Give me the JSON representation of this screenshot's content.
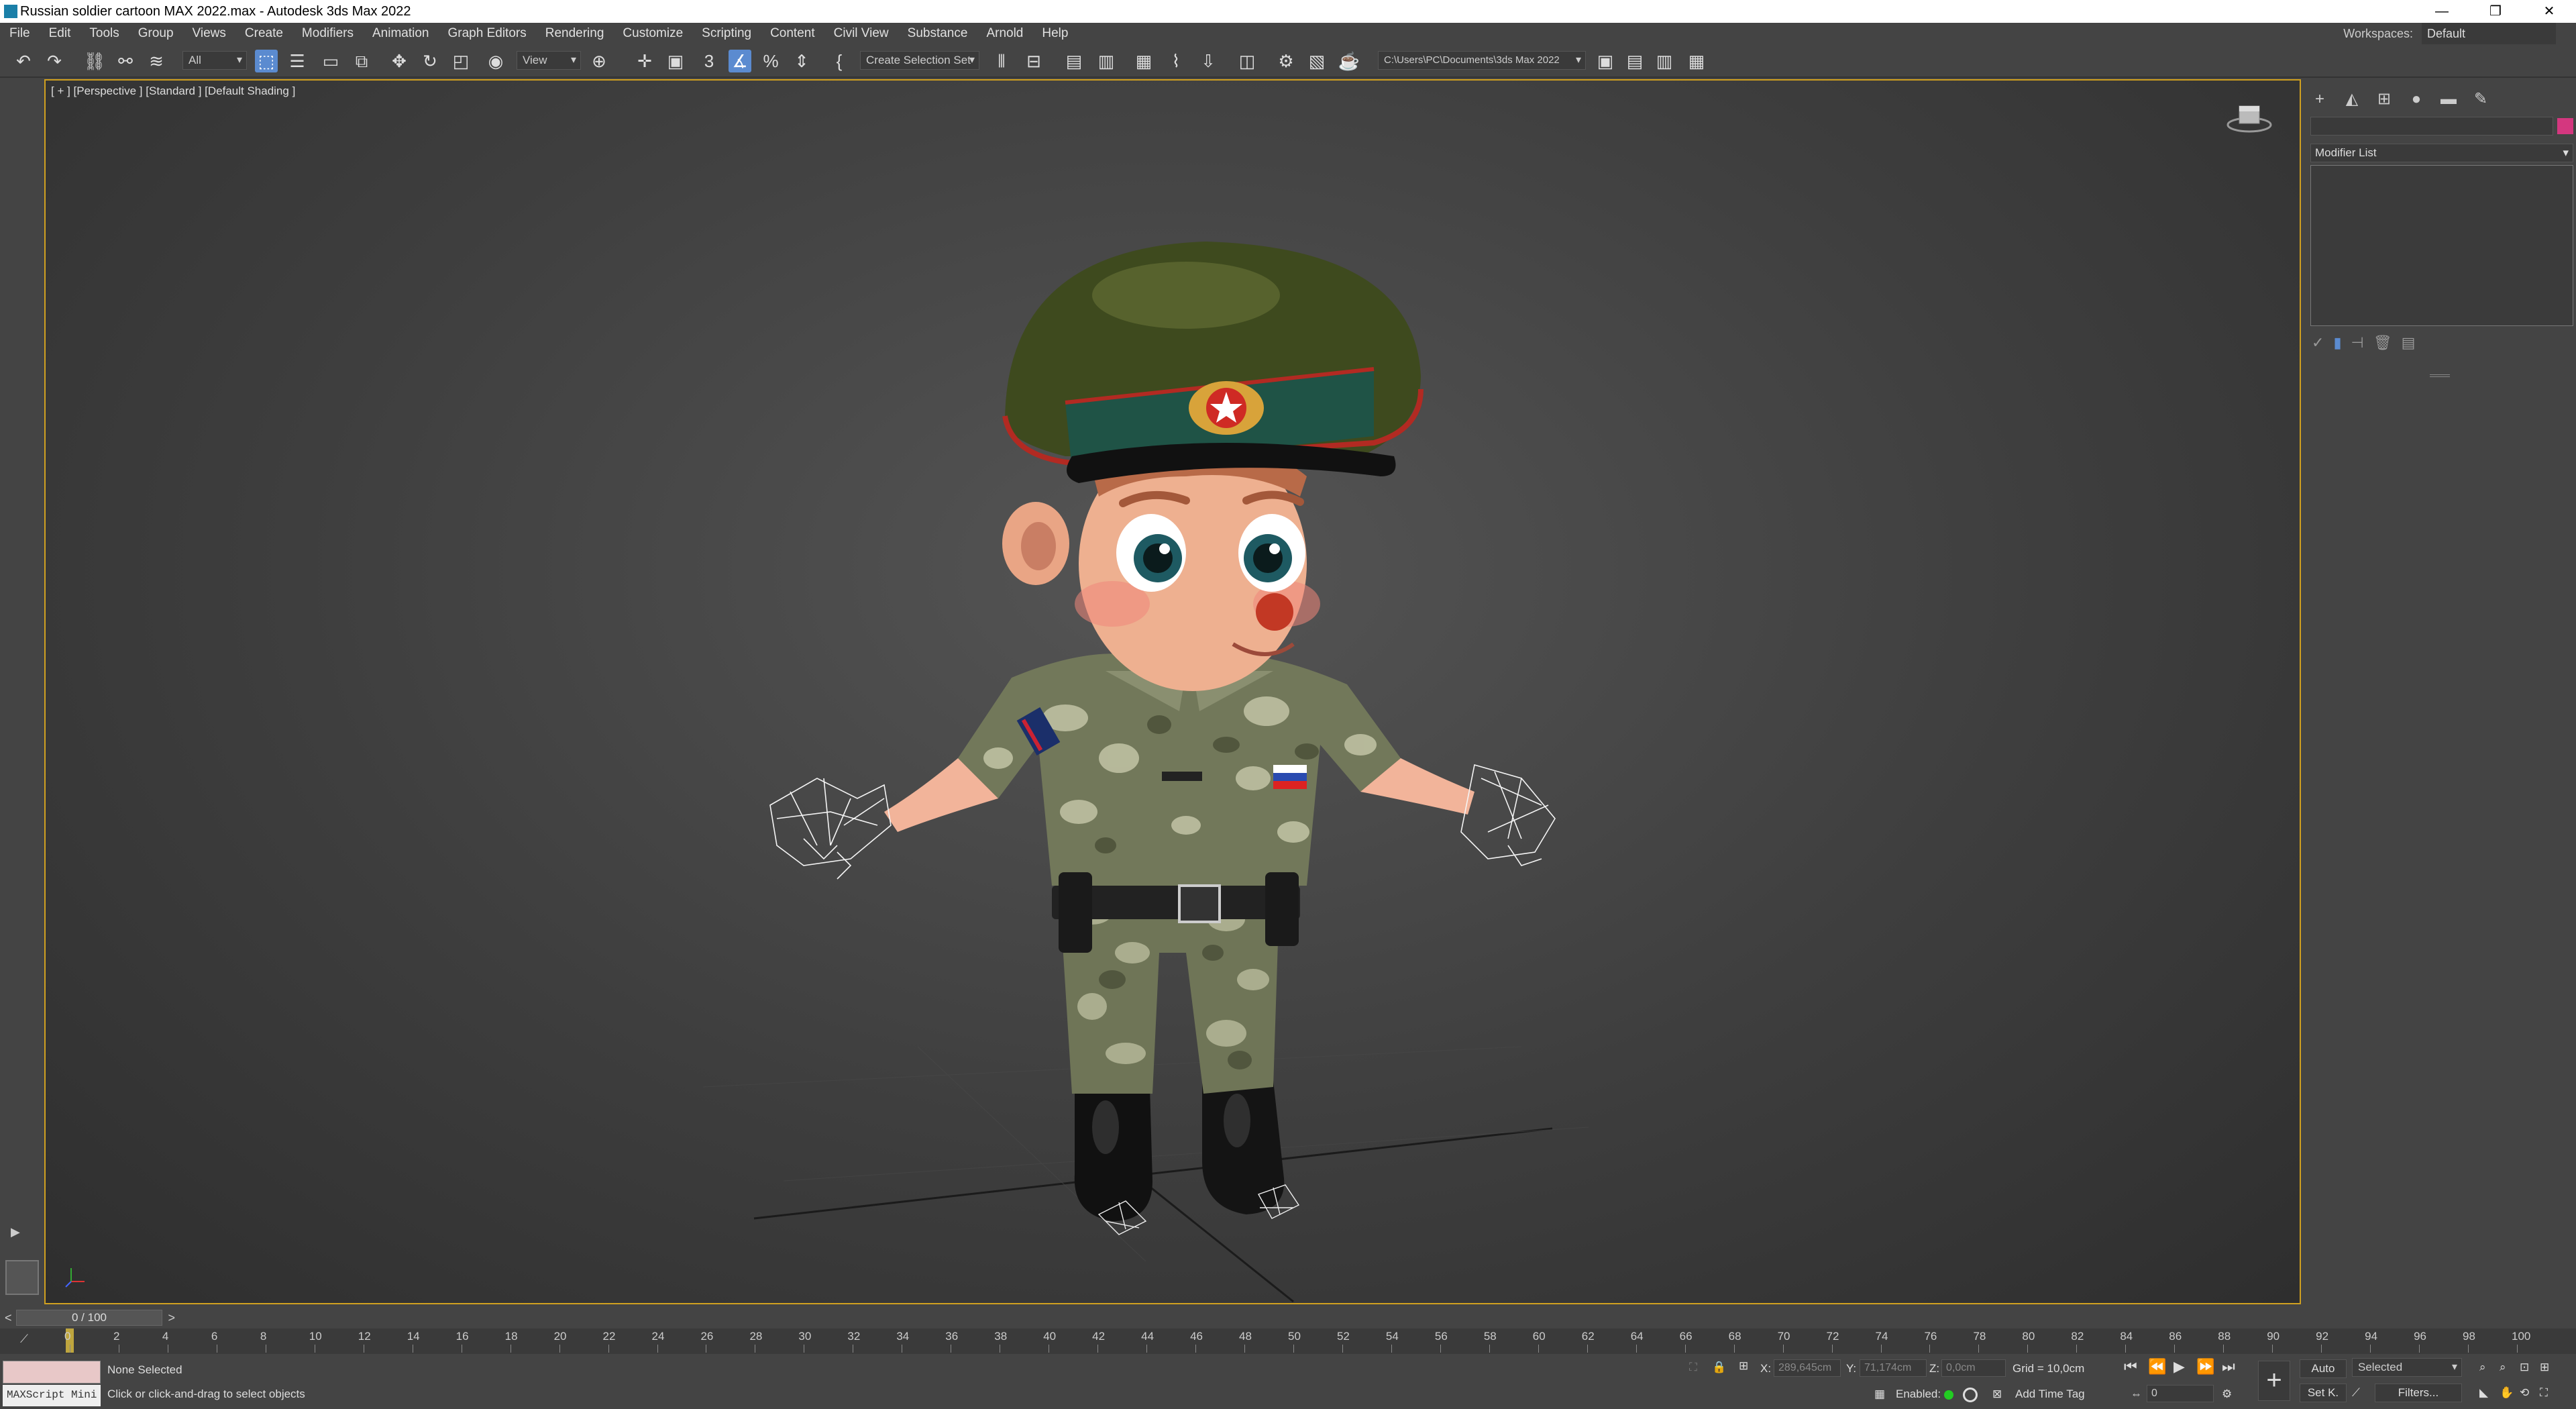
{
  "window": {
    "title": "Russian soldier cartoon MAX 2022.max - Autodesk 3ds Max 2022",
    "minimize": "—",
    "restore": "❐",
    "close": "✕"
  },
  "menu": [
    "File",
    "Edit",
    "Tools",
    "Group",
    "Views",
    "Create",
    "Modifiers",
    "Animation",
    "Graph Editors",
    "Rendering",
    "Customize",
    "Scripting",
    "Content",
    "Civil View",
    "Substance",
    "Arnold",
    "Help"
  ],
  "workspace": {
    "label": "Workspaces:",
    "value": "Default"
  },
  "toolbar": {
    "selection_filter": "All",
    "ref_coord": "View",
    "selection_set": "Create Selection Set",
    "project_path": "C:\\Users\\PC\\Documents\\3ds Max 2022",
    "snap_label": "3"
  },
  "viewport": {
    "label": "[ + ] [Perspective ] [Standard ] [Default Shading ]"
  },
  "command_panel": {
    "modifier_list": "Modifier List",
    "swatch_color": "#d4377f"
  },
  "timeline": {
    "frame_display": "0 / 100",
    "prev": "<",
    "next": ">",
    "ticks": [
      "0",
      "2",
      "4",
      "6",
      "8",
      "10",
      "12",
      "14",
      "16",
      "18",
      "20",
      "22",
      "24",
      "26",
      "28",
      "30",
      "32",
      "34",
      "36",
      "38",
      "40",
      "42",
      "44",
      "46",
      "48",
      "50",
      "52",
      "54",
      "56",
      "58",
      "60",
      "62",
      "64",
      "66",
      "68",
      "70",
      "72",
      "74",
      "76",
      "78",
      "80",
      "82",
      "84",
      "86",
      "88",
      "90",
      "92",
      "94",
      "96",
      "98",
      "100"
    ]
  },
  "status": {
    "maxscript": "MAXScript Mini",
    "selection": "None Selected",
    "prompt": "Click or click-and-drag to select objects",
    "x_label": "X:",
    "x_value": "289,645cm",
    "y_label": "Y:",
    "y_value": "71,174cm",
    "z_label": "Z:",
    "z_value": "0,0cm",
    "grid": "Grid = 10,0cm",
    "enabled": "Enabled:",
    "add_time_tag": "Add Time Tag",
    "auto": "Auto",
    "selected": "Selected",
    "set_key": "Set K.",
    "filters": "Filters...",
    "frame_field": "0"
  }
}
